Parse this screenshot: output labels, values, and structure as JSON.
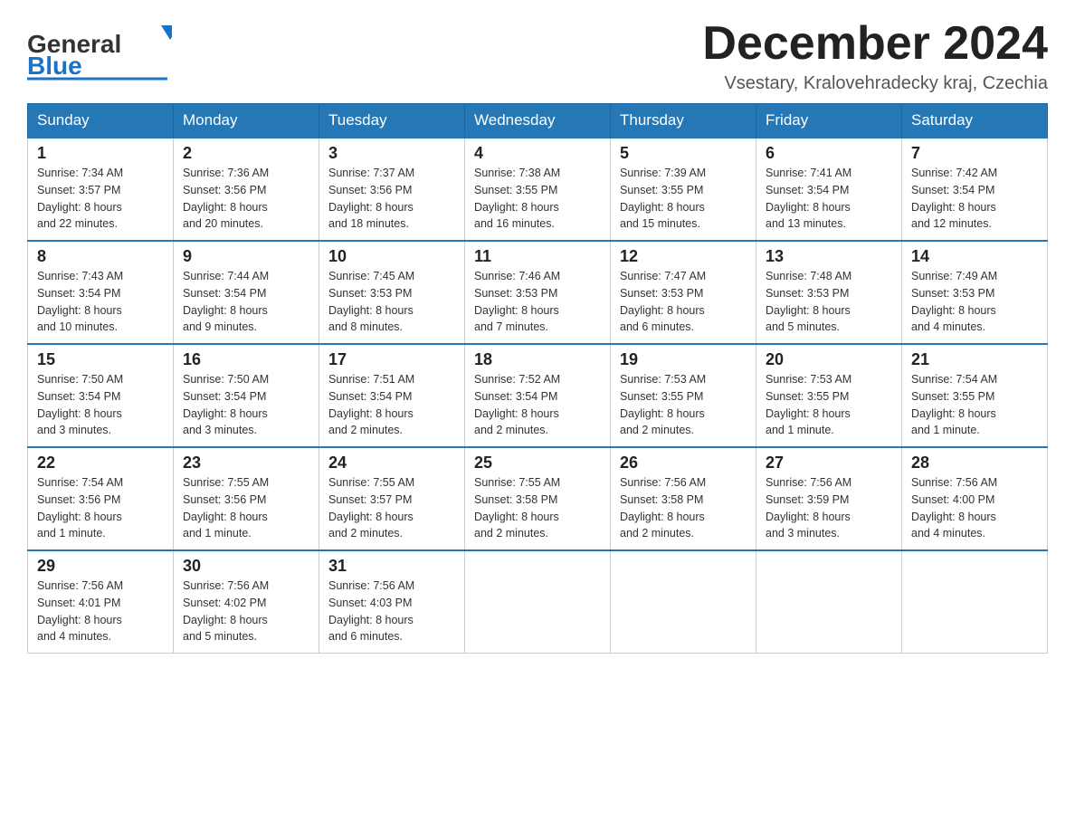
{
  "header": {
    "logo_text_general": "General",
    "logo_text_blue": "Blue",
    "month_title": "December 2024",
    "location": "Vsestary, Kralovehradecky kraj, Czechia"
  },
  "days_of_week": [
    "Sunday",
    "Monday",
    "Tuesday",
    "Wednesday",
    "Thursday",
    "Friday",
    "Saturday"
  ],
  "weeks": [
    [
      {
        "day": "1",
        "sunrise": "7:34 AM",
        "sunset": "3:57 PM",
        "daylight": "8 hours and 22 minutes."
      },
      {
        "day": "2",
        "sunrise": "7:36 AM",
        "sunset": "3:56 PM",
        "daylight": "8 hours and 20 minutes."
      },
      {
        "day": "3",
        "sunrise": "7:37 AM",
        "sunset": "3:56 PM",
        "daylight": "8 hours and 18 minutes."
      },
      {
        "day": "4",
        "sunrise": "7:38 AM",
        "sunset": "3:55 PM",
        "daylight": "8 hours and 16 minutes."
      },
      {
        "day": "5",
        "sunrise": "7:39 AM",
        "sunset": "3:55 PM",
        "daylight": "8 hours and 15 minutes."
      },
      {
        "day": "6",
        "sunrise": "7:41 AM",
        "sunset": "3:54 PM",
        "daylight": "8 hours and 13 minutes."
      },
      {
        "day": "7",
        "sunrise": "7:42 AM",
        "sunset": "3:54 PM",
        "daylight": "8 hours and 12 minutes."
      }
    ],
    [
      {
        "day": "8",
        "sunrise": "7:43 AM",
        "sunset": "3:54 PM",
        "daylight": "8 hours and 10 minutes."
      },
      {
        "day": "9",
        "sunrise": "7:44 AM",
        "sunset": "3:54 PM",
        "daylight": "8 hours and 9 minutes."
      },
      {
        "day": "10",
        "sunrise": "7:45 AM",
        "sunset": "3:53 PM",
        "daylight": "8 hours and 8 minutes."
      },
      {
        "day": "11",
        "sunrise": "7:46 AM",
        "sunset": "3:53 PM",
        "daylight": "8 hours and 7 minutes."
      },
      {
        "day": "12",
        "sunrise": "7:47 AM",
        "sunset": "3:53 PM",
        "daylight": "8 hours and 6 minutes."
      },
      {
        "day": "13",
        "sunrise": "7:48 AM",
        "sunset": "3:53 PM",
        "daylight": "8 hours and 5 minutes."
      },
      {
        "day": "14",
        "sunrise": "7:49 AM",
        "sunset": "3:53 PM",
        "daylight": "8 hours and 4 minutes."
      }
    ],
    [
      {
        "day": "15",
        "sunrise": "7:50 AM",
        "sunset": "3:54 PM",
        "daylight": "8 hours and 3 minutes."
      },
      {
        "day": "16",
        "sunrise": "7:50 AM",
        "sunset": "3:54 PM",
        "daylight": "8 hours and 3 minutes."
      },
      {
        "day": "17",
        "sunrise": "7:51 AM",
        "sunset": "3:54 PM",
        "daylight": "8 hours and 2 minutes."
      },
      {
        "day": "18",
        "sunrise": "7:52 AM",
        "sunset": "3:54 PM",
        "daylight": "8 hours and 2 minutes."
      },
      {
        "day": "19",
        "sunrise": "7:53 AM",
        "sunset": "3:55 PM",
        "daylight": "8 hours and 2 minutes."
      },
      {
        "day": "20",
        "sunrise": "7:53 AM",
        "sunset": "3:55 PM",
        "daylight": "8 hours and 1 minute."
      },
      {
        "day": "21",
        "sunrise": "7:54 AM",
        "sunset": "3:55 PM",
        "daylight": "8 hours and 1 minute."
      }
    ],
    [
      {
        "day": "22",
        "sunrise": "7:54 AM",
        "sunset": "3:56 PM",
        "daylight": "8 hours and 1 minute."
      },
      {
        "day": "23",
        "sunrise": "7:55 AM",
        "sunset": "3:56 PM",
        "daylight": "8 hours and 1 minute."
      },
      {
        "day": "24",
        "sunrise": "7:55 AM",
        "sunset": "3:57 PM",
        "daylight": "8 hours and 2 minutes."
      },
      {
        "day": "25",
        "sunrise": "7:55 AM",
        "sunset": "3:58 PM",
        "daylight": "8 hours and 2 minutes."
      },
      {
        "day": "26",
        "sunrise": "7:56 AM",
        "sunset": "3:58 PM",
        "daylight": "8 hours and 2 minutes."
      },
      {
        "day": "27",
        "sunrise": "7:56 AM",
        "sunset": "3:59 PM",
        "daylight": "8 hours and 3 minutes."
      },
      {
        "day": "28",
        "sunrise": "7:56 AM",
        "sunset": "4:00 PM",
        "daylight": "8 hours and 4 minutes."
      }
    ],
    [
      {
        "day": "29",
        "sunrise": "7:56 AM",
        "sunset": "4:01 PM",
        "daylight": "8 hours and 4 minutes."
      },
      {
        "day": "30",
        "sunrise": "7:56 AM",
        "sunset": "4:02 PM",
        "daylight": "8 hours and 5 minutes."
      },
      {
        "day": "31",
        "sunrise": "7:56 AM",
        "sunset": "4:03 PM",
        "daylight": "8 hours and 6 minutes."
      },
      null,
      null,
      null,
      null
    ]
  ],
  "labels": {
    "sunrise": "Sunrise:",
    "sunset": "Sunset:",
    "daylight": "Daylight:"
  }
}
